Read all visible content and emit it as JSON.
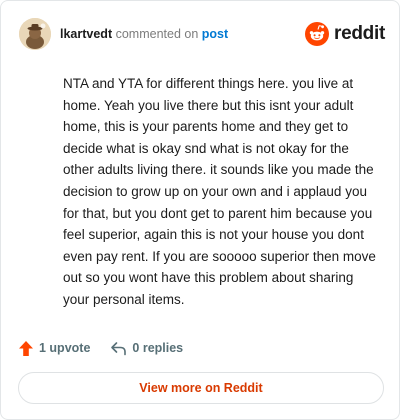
{
  "comment": {
    "username": "lkartvedt",
    "action_text": "commented on",
    "post_link_text": "post",
    "body": "NTA and YTA for different things here. you live at home. Yeah you live there but this isnt your adult home, this is your parents home and they get to decide what is okay snd what is not okay for the other adults living there. it sounds like you made the decision to grow up on your own and i applaud you for that, but you dont get to parent him because you feel superior, again this is not your house you dont even pay rent. If you are sooooo superior then move out so you wont have this problem about sharing your personal items."
  },
  "brand": {
    "name": "reddit",
    "icon": "reddit-logo-icon",
    "color": "#ff4500"
  },
  "footer": {
    "upvotes_label": "1 upvote",
    "upvote_icon": "upvote-arrow-icon",
    "upvote_color": "#ff4500",
    "replies_label": "0 replies",
    "reply_icon": "reply-arrow-icon"
  },
  "cta": {
    "label": "View more on Reddit",
    "color": "#d93a00"
  }
}
